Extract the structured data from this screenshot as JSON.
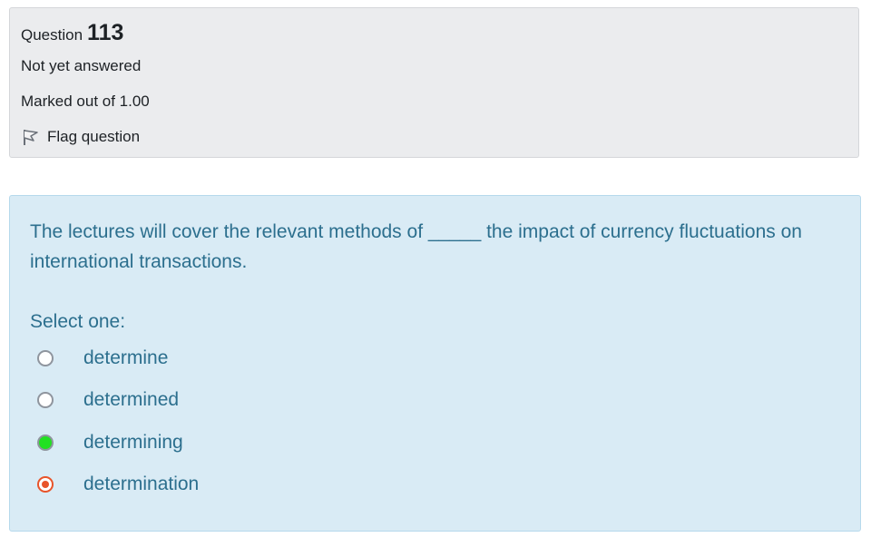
{
  "question_info": {
    "label": "Question",
    "number": "113",
    "status": "Not yet answered",
    "marks": "Marked out of 1.00",
    "flag_label": "Flag question"
  },
  "question": {
    "text": "The lectures will cover the relevant methods of _____ the impact of currency fluctuations on international transactions.",
    "prompt": "Select one:",
    "options": [
      {
        "label": "determine",
        "state": "unselected"
      },
      {
        "label": "determined",
        "state": "unselected"
      },
      {
        "label": "determining",
        "state": "highlighted-green"
      },
      {
        "label": "determination",
        "state": "selected"
      }
    ]
  },
  "colors": {
    "info_background": "#ebecee",
    "content_background": "#d9ebf5",
    "content_text": "#2c6f8e",
    "selected_radio": "#e8542a",
    "green_radio": "#22e022"
  }
}
